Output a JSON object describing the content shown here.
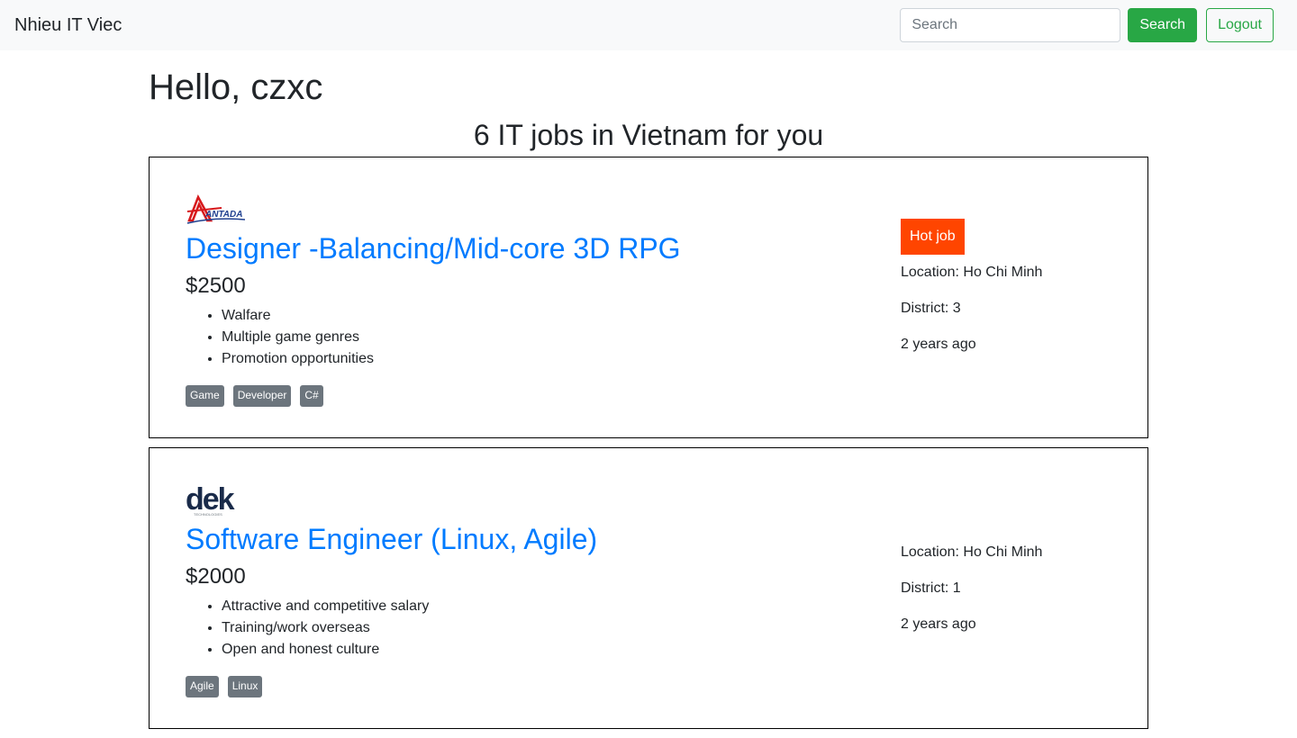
{
  "navbar": {
    "brand": "Nhieu IT Viec",
    "search_placeholder": "Search",
    "search_value": "",
    "search_button": "Search",
    "logout_button": "Logout"
  },
  "main": {
    "greeting": "Hello, czxc",
    "subtitle": "6 IT jobs in Vietnam for you"
  },
  "jobs": [
    {
      "logo": "ANTADA",
      "title": "Designer -Balancing/Mid-core 3D RPG",
      "salary": "$2500",
      "benefits": [
        "Walfare",
        "Multiple game genres",
        "Promotion opportunities"
      ],
      "tags": [
        "Game",
        "Developer",
        "C#"
      ],
      "hot": "Hot job",
      "location": "Location: Ho Chi Minh",
      "district": "District: 3",
      "posted": "2 years ago"
    },
    {
      "logo": "dek",
      "logo_sub": "TECHNOLOGIES",
      "title": "Software Engineer (Linux, Agile)",
      "salary": "$2000",
      "benefits": [
        "Attractive and competitive salary",
        "Training/work overseas",
        "Open and honest culture"
      ],
      "tags": [
        "Agile",
        "Linux"
      ],
      "location": "Location: Ho Chi Minh",
      "district": "District: 1",
      "posted": "2 years ago"
    }
  ],
  "colors": {
    "link": "#007bff",
    "success": "#28a745",
    "hot": "#ff4500",
    "tag": "#6c757d"
  }
}
